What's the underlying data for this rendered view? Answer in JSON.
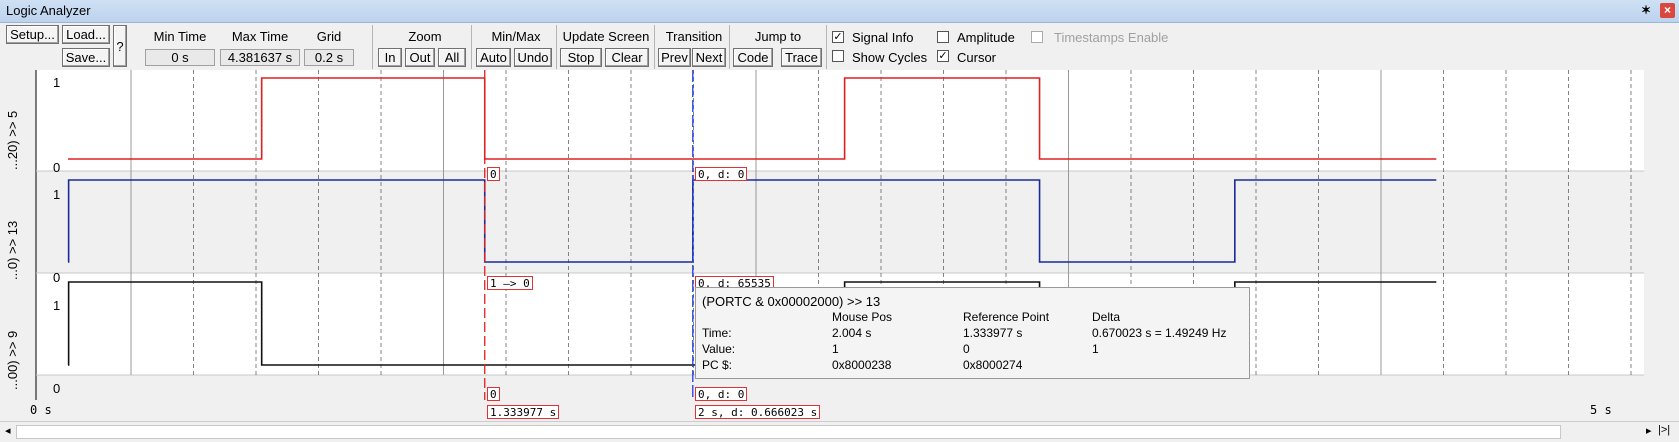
{
  "window": {
    "title": "Logic Analyzer",
    "pin_glyph": "✶",
    "close_glyph": "×"
  },
  "toolbar": {
    "setup": "Setup...",
    "load": "Load...",
    "save": "Save...",
    "help": "?",
    "min_time_label": "Min Time",
    "min_time_value": "0 s",
    "max_time_label": "Max Time",
    "max_time_value": "4.381637 s",
    "grid_label": "Grid",
    "grid_value": "0.2 s",
    "zoom_label": "Zoom",
    "zoom_in": "In",
    "zoom_out": "Out",
    "zoom_all": "All",
    "minmax_label": "Min/Max",
    "auto": "Auto",
    "undo": "Undo",
    "update_label": "Update Screen",
    "stop": "Stop",
    "clear": "Clear",
    "transition_label": "Transition",
    "prev": "Prev",
    "next": "Next",
    "jump_label": "Jump to",
    "code": "Code",
    "trace": "Trace",
    "signal_info": "Signal Info",
    "show_cycles": "Show Cycles",
    "amplitude": "Amplitude",
    "cursor": "Cursor",
    "timestamps": "Timestamps Enable",
    "signal_info_checked": true,
    "show_cycles_checked": false,
    "amplitude_checked": false,
    "cursor_checked": true,
    "timestamps_checked": false
  },
  "signals": [
    {
      "label": "...20) >> 5",
      "high": "1",
      "low": "0",
      "color": "#e02020",
      "bg": "#ffffff"
    },
    {
      "label": "...0) >> 13",
      "high": "1",
      "low": "0",
      "color": "#1a2a9a",
      "bg": "#f0f0f0"
    },
    {
      "label": "...00) >> 9",
      "high": "1",
      "low": "0",
      "color": "#111111",
      "bg": "#ffffff"
    }
  ],
  "markers": {
    "ref_sig1": "0",
    "ref_sig2": "1 —> 0",
    "ref_sig3": "0",
    "cur_sig1": "0,  d: 0",
    "cur_sig2": "0,  d: 65535",
    "cur_sig3": "0,  d: 0",
    "ref_time": "1.333977 s",
    "cur_time": "2 s,  d: 0.666023 s"
  },
  "axis": {
    "start": "0 s",
    "end": "5 s"
  },
  "tooltip": {
    "title": "(PORTC & 0x00002000) >> 13",
    "col_mouse": "Mouse Pos",
    "col_ref": "Reference Point",
    "col_delta": "Delta",
    "row_time": "Time:",
    "row_value": "Value:",
    "row_pc": "PC $:",
    "mouse_time": "2.004 s",
    "ref_time": "1.333977 s",
    "delta_time": "0.670023 s = 1.49249 Hz",
    "mouse_value": "1",
    "ref_value": "0",
    "delta_value": "1",
    "mouse_pc": "0x8000238",
    "ref_pc": "0x8000274"
  },
  "scrollbar": {
    "left": "◂",
    "right": "▸",
    "end": "|>|"
  }
}
